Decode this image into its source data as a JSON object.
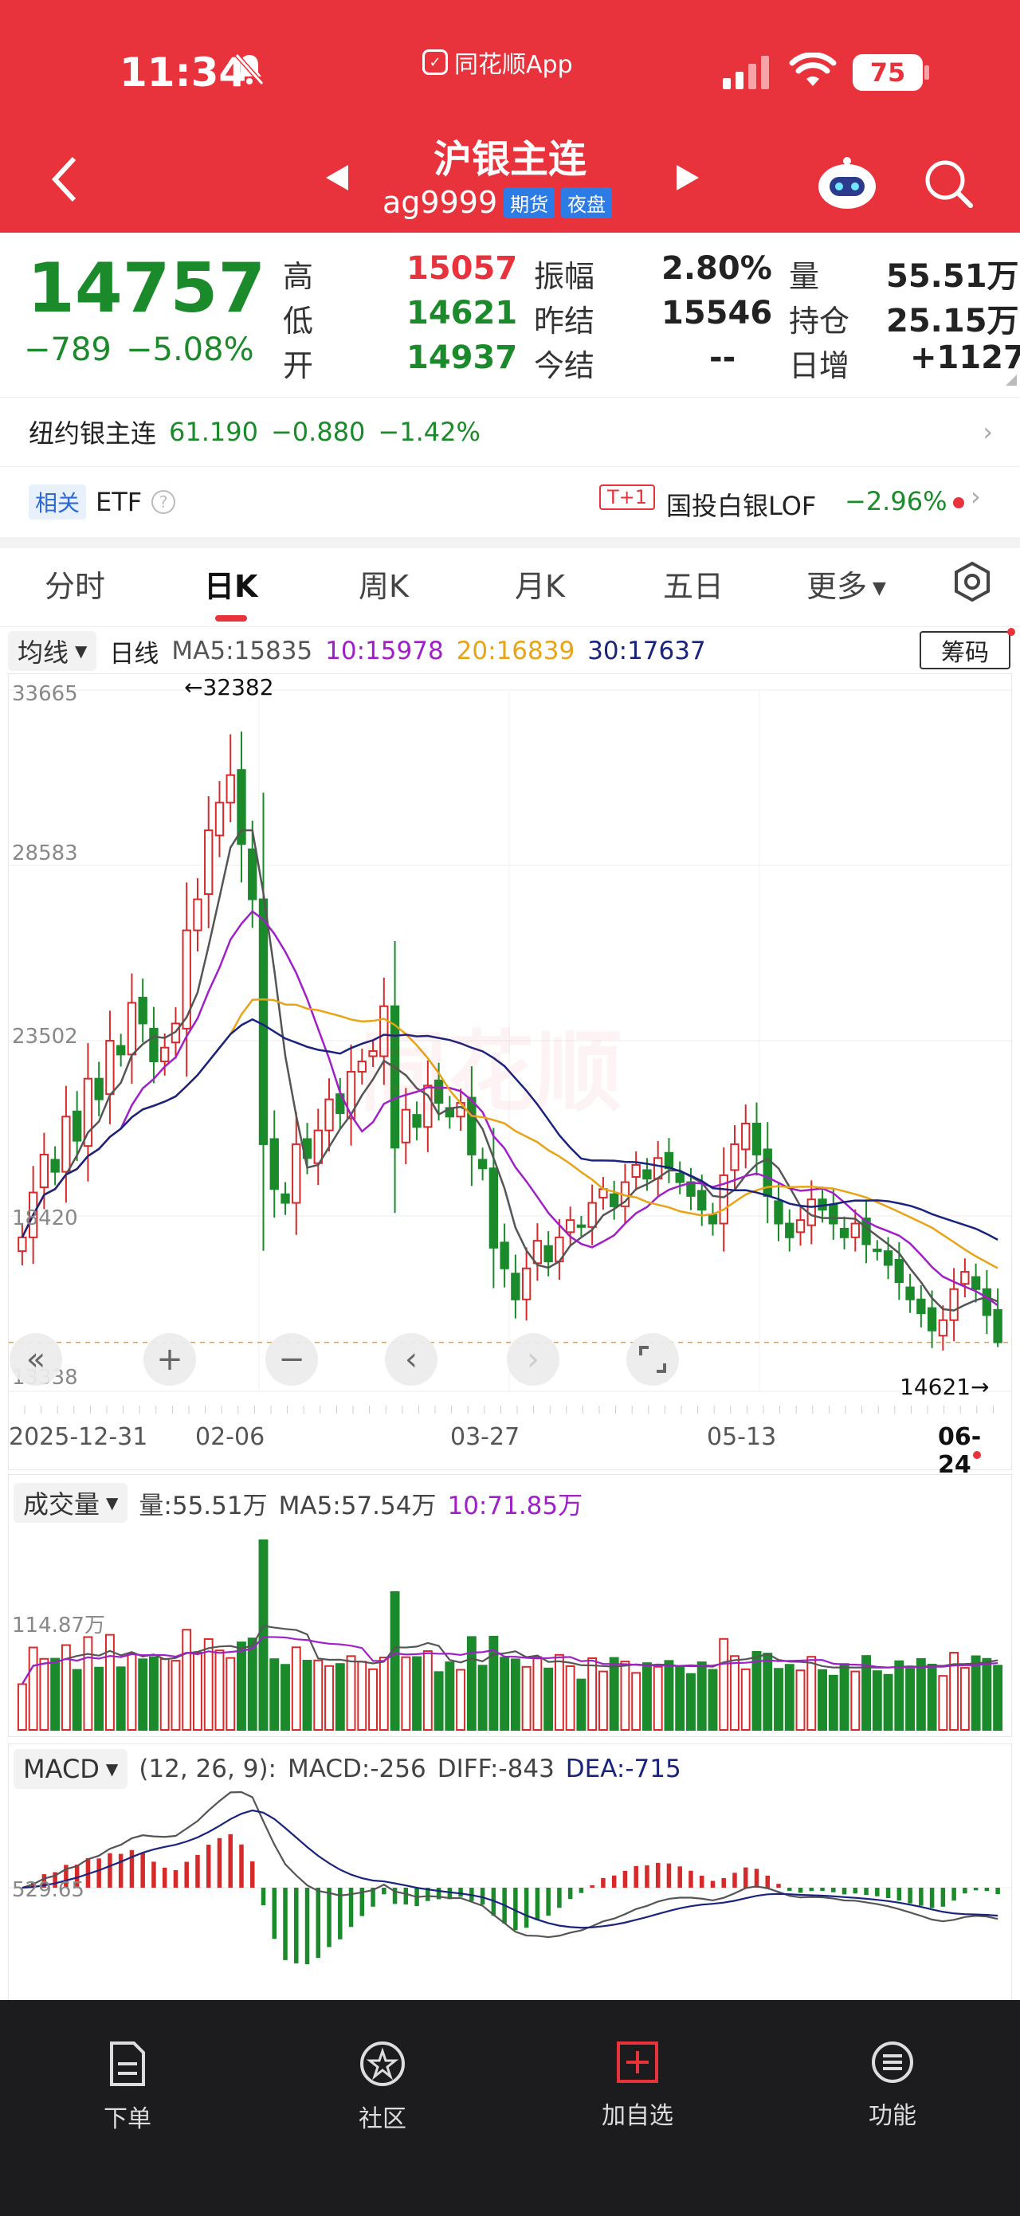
{
  "status_bar": {
    "time": "11:34",
    "app_name": "同花顺App",
    "battery": "75"
  },
  "header": {
    "title": "沪银主连",
    "code": "ag9999",
    "badge_futures": "期货",
    "badge_night": "夜盘"
  },
  "quote": {
    "price": "14757",
    "change": "−789",
    "change_pct": "−5.08%",
    "high_label": "高",
    "high": "15057",
    "low_label": "低",
    "low": "14621",
    "open_label": "开",
    "open": "14937",
    "amp_label": "振幅",
    "amp": "2.80%",
    "prev_settle_label": "昨结",
    "prev_settle": "15546",
    "settle_label": "今结",
    "settle": "--",
    "vol_label": "量",
    "vol": "55.51万",
    "oi_label": "持仓",
    "oi": "25.15万",
    "oi_inc_label": "日增",
    "oi_inc": "+1127"
  },
  "related_contract": {
    "name": "纽约银主连",
    "price": "61.190",
    "change": "−0.880",
    "pct": "−1.42%"
  },
  "related_etf": {
    "tag": "相关",
    "label": "ETF",
    "t1": "T+1",
    "fund_name": "国投白银LOF",
    "fund_pct": "−2.96%"
  },
  "tabs": [
    "分时",
    "日K",
    "周K",
    "月K",
    "五日",
    "更多"
  ],
  "active_tab": 1,
  "ma_bar": {
    "mode": "均线",
    "period": "日线",
    "ma5": "MA5:15835",
    "ma10": "10:15978",
    "ma20": "20:16839",
    "ma30": "30:17637",
    "chip_button": "筹码"
  },
  "price_chart": {
    "y_labels": [
      "33665",
      "28583",
      "23502",
      "18420",
      "13338"
    ],
    "high_marker": "←32382",
    "low_marker": "14621→",
    "x_labels": [
      "2025-12-31",
      "02-06",
      "03-27",
      "05-13",
      "06-24"
    ],
    "watermark": "同花顺"
  },
  "volume_bar": {
    "mode": "成交量",
    "vol": "量:55.51万",
    "ma5": "MA5:57.54万",
    "ma10": "10:71.85万",
    "ref": "114.87万"
  },
  "macd_bar": {
    "mode": "MACD",
    "params": "(12, 26, 9):",
    "macd": "MACD:-256",
    "diff": "DIFF:-843",
    "dea": "DEA:-715",
    "ref": "529.65"
  },
  "bottom_nav": [
    "下单",
    "社区",
    "加自选",
    "功能"
  ],
  "colors": {
    "header": "#e8323c",
    "up": "#d62a2a",
    "down": "#1b8a2a",
    "ma5": "#555555",
    "ma10": "#a020c8",
    "ma20": "#e8a317",
    "ma30": "#1a237e"
  },
  "chart_data": {
    "type": "candlestick",
    "title": "沪银主连 日K",
    "x_range": [
      "2025-12-31",
      "06-24"
    ],
    "ylim": [
      13338,
      33665
    ],
    "y_ticks": [
      33665,
      28583,
      23502,
      18420,
      13338
    ],
    "period_high": 32382,
    "period_low": 14621,
    "close": [
      17800,
      19100,
      20200,
      19700,
      21300,
      20600,
      22400,
      21800,
      23500,
      23100,
      24600,
      24000,
      22900,
      23300,
      24000,
      26700,
      27600,
      29600,
      30400,
      31200,
      29200,
      27600,
      20500,
      19200,
      18800,
      20500,
      20100,
      20900,
      21800,
      21400,
      22600,
      22900,
      23200,
      24500,
      20400,
      21500,
      21000,
      22200,
      21700,
      21300,
      21700,
      20200,
      19800,
      17500,
      16900,
      16000,
      16900,
      17700,
      17100,
      17800,
      18300,
      18100,
      18800,
      19200,
      18700,
      19400,
      19900,
      19500,
      20100,
      19800,
      19400,
      19000,
      18600,
      18200,
      19600,
      20500,
      21100,
      20200,
      19000,
      18200,
      17800,
      18300,
      18900,
      18600,
      18200,
      17800,
      18200,
      17600,
      17400,
      17000,
      16500,
      16000,
      15600,
      15100,
      15400,
      16300,
      16800,
      16300,
      15546,
      14757
    ]
  }
}
